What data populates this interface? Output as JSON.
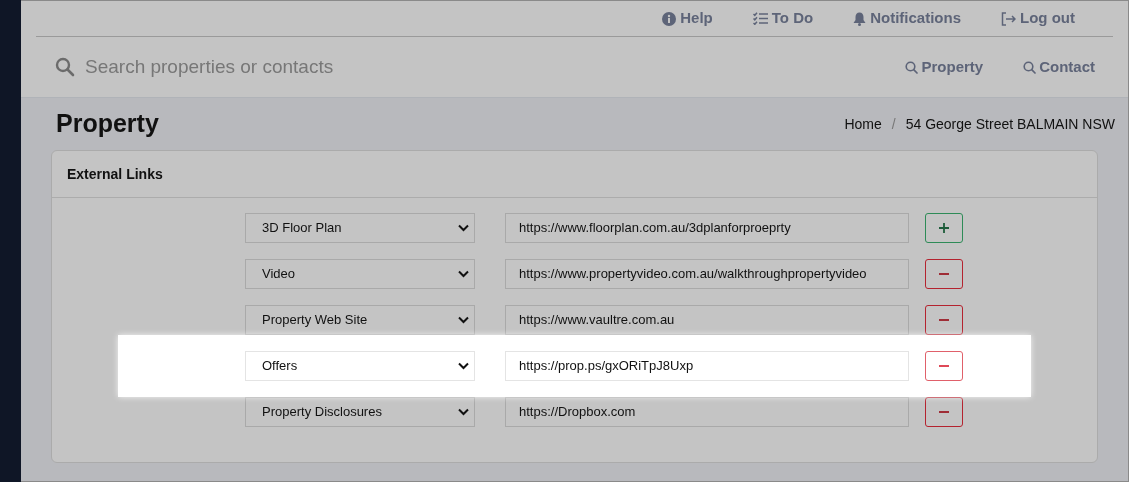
{
  "top_nav": [
    {
      "kind": "help",
      "label": "Help"
    },
    {
      "kind": "todo",
      "label": "To Do"
    },
    {
      "kind": "bell",
      "label": "Notifications"
    },
    {
      "kind": "logout",
      "label": "Log out"
    }
  ],
  "search": {
    "placeholder": "Search properties or contacts",
    "buttons": [
      "Property",
      "Contact"
    ]
  },
  "page_title": "Property",
  "breadcrumb": {
    "items": [
      "Home",
      "54 George Street BALMAIN NSW"
    ],
    "separator": "/"
  },
  "card": {
    "title": "External Links",
    "rows": [
      {
        "type": "3D Floor Plan",
        "url": "https://www.floorplan.com.au/3dplanforproeprty",
        "kind": "add",
        "highlighted": false
      },
      {
        "type": "Video",
        "url": "https://www.propertyvideo.com.au/walkthroughpropertyvideo",
        "kind": "remove",
        "highlighted": false
      },
      {
        "type": "Property Web Site",
        "url": "https://www.vaultre.com.au",
        "kind": "remove",
        "highlighted": false
      },
      {
        "type": "Offers",
        "url": "https://prop.ps/gxORiTpJ8Uxp",
        "kind": "remove",
        "highlighted": true
      },
      {
        "type": "Property Disclosures",
        "url": "https://Dropbox.com",
        "kind": "remove",
        "highlighted": false
      }
    ]
  }
}
